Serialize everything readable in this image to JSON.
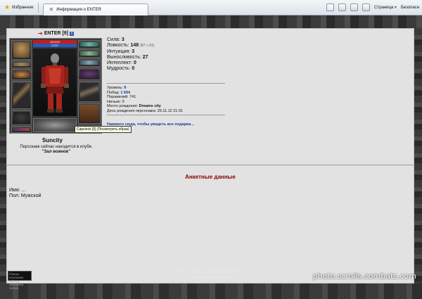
{
  "browser": {
    "favorites_label": "Избранное",
    "tab_title": "Информация о ENTER",
    "page_menu": "Страница",
    "safety_menu": "Безопасн"
  },
  "character": {
    "name": "ENTER",
    "level_badge": "[9]",
    "info_icon": "i",
    "hp_text": "220/220",
    "mp_text": "27/27",
    "tooltip": "Capslock [5] (Посмотреть образ)",
    "city": "Suncity",
    "status_line": "Персонаж сейчас находится в клубе.",
    "location": "\"Зал воинов\""
  },
  "stats": {
    "strength_label": "Сила:",
    "strength_value": "3",
    "agility_label": "Ловкость:",
    "agility_value": "148",
    "agility_extra": "(87 + 61)",
    "intuition_label": "Интуиция:",
    "intuition_value": "3",
    "stamina_label": "Выносливость:",
    "stamina_value": "27",
    "intellect_label": "Интеллект:",
    "intellect_value": "0",
    "wisdom_label": "Мудрость:",
    "wisdom_value": "0"
  },
  "meta": {
    "level_label": "Уровень:",
    "level_value": "9",
    "wins_label": "Побед:",
    "wins_value": "1 694",
    "losses_label": "Поражений:",
    "losses_value": "741",
    "draws_label": "Ничьих:",
    "draws_value": "9",
    "birthplace_label": "Место рождения:",
    "birthplace_value": "Dreams city",
    "birthday_label": "День рождения персонажа:",
    "birthday_value": "29.11.12 21:31"
  },
  "gift_link": "Нажмите сюда, чтобы увидеть все подарки...",
  "profile": {
    "section_title": "Анкетные данные",
    "name_label": "Имя:",
    "name_value": "...",
    "gender_label": "Пол:",
    "gender_value": "Мужской"
  },
  "footer": {
    "copyright_line1": "© 2002 - 2013, «www.Combats.com»™",
    "copyright_line2": "All rights reserved",
    "watermark": "photo.scrolls.combats.com",
    "counter_line1": "Рейтинг  394216506",
    "counter_line2": "мэйл.ру  394216506",
    "counter_line3": "130328"
  },
  "colors": {
    "accent_red": "#8b0000",
    "link_blue": "#1a3d9c",
    "hp": "#c41d1d",
    "mp": "#2858b8"
  }
}
